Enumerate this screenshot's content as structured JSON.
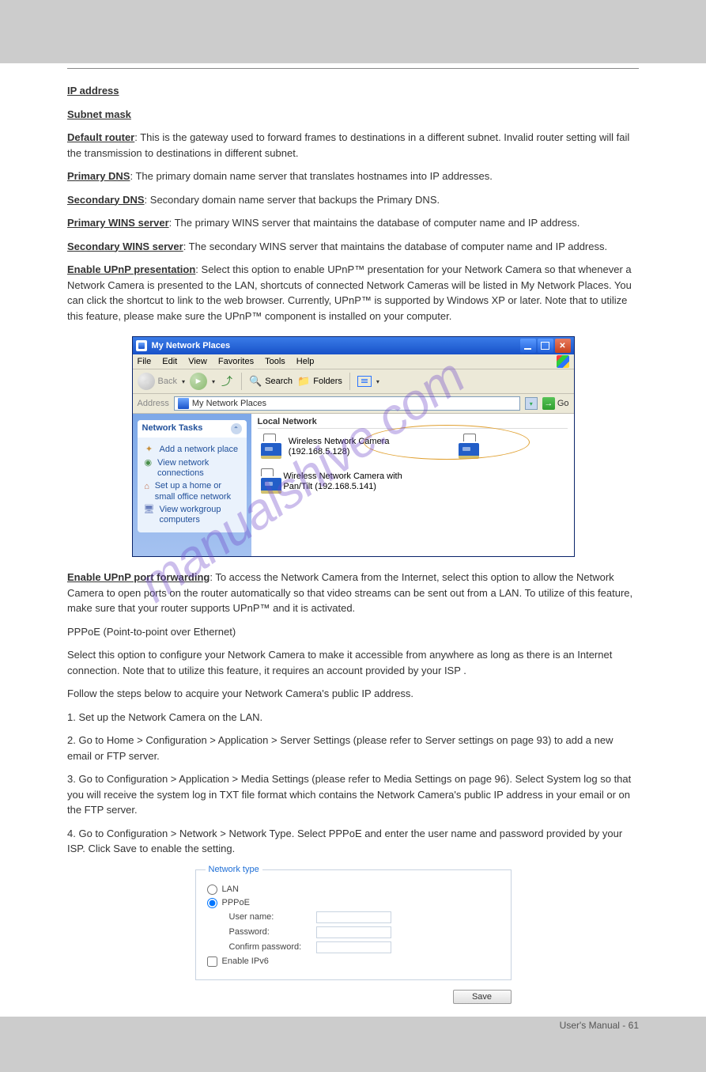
{
  "sections": {
    "ip_address": "IP address",
    "subnet_mask": "Subnet mask",
    "default_router": "Default router",
    "default_router_desc": ": This is the gateway used to forward frames to destinations in a different subnet. Invalid router setting will fail the transmission to destinations in different subnet.",
    "primary_dns": "Primary DNS",
    "primary_dns_desc": ": The primary domain name server that translates hostnames into IP addresses.",
    "secondary_dns": "Secondary DNS",
    "secondary_dns_desc": ": Secondary domain name server that backups the Primary DNS.",
    "primary_wins": "Primary WINS server",
    "primary_wins_desc": ": The primary WINS server that maintains the database of computer name and IP address.",
    "secondary_wins": "Secondary WINS server",
    "secondary_wins_desc": ": The secondary WINS server that maintains the database of computer name and IP address.",
    "enable_upnp": "Enable UPnP presentation",
    "enable_upnp_desc": ": Select this option to enable UPnP™ presentation for your Network Camera so that whenever a Network Camera is presented to the LAN, shortcuts of connected Network Cameras will be listed in My Network Places. You can click the shortcut to link to the web browser. Currently, UPnP™ is supported by Windows XP or later. Note that to utilize this feature, please make sure the UPnP™ component is installed on your computer.",
    "enable_portfwd": "Enable UPnP port forwarding",
    "enable_portfwd_desc": ": To access the Network Camera from the Internet, select this option to allow the Network Camera to open ports on the router automatically so that video streams can be sent out from a LAN. To utilize of this feature, make sure that your router supports UPnP™ and it is activated.",
    "pppoe_heading": "PPPoE (Point-to-point over Ethernet)",
    "pppoe_desc": "Select this option to configure your Network Camera to make it accessible from anywhere as long as there is an Internet connection. Note that to utilize this feature, it requires an account provided by your ISP .",
    "pppoe_steps": "Follow the steps below to acquire your Network Camera's public IP address.",
    "step1": "1. Set up the Network Camera on the LAN.",
    "step2": "2. Go to Home > Configuration > Application > Server Settings (please refer to Server settings on page 93) to add a new email or FTP server.",
    "step3": "3. Go to Configuration > Application > Media Settings (please refer to Media Settings on page 96). Select System log so that you will receive the system log in TXT file format which contains the Network Camera's public IP address in your email or on the FTP server.",
    "step4": "4. Go to Configuration > Network > Network Type. Select PPPoE and enter the user name and password provided by your ISP. Click Save to enable the setting."
  },
  "xp_window": {
    "title": "My Network Places",
    "menu": [
      "File",
      "Edit",
      "View",
      "Favorites",
      "Tools",
      "Help"
    ],
    "toolbar": {
      "back": "Back",
      "search": "Search",
      "folders": "Folders"
    },
    "address_label": "Address",
    "address": "My Network Places",
    "go": "Go",
    "tasks_title": "Network Tasks",
    "tasks": {
      "add": "Add a network place",
      "view": "View network connections",
      "setup": "Set up a home or small office network",
      "workgroup": "View workgroup computers"
    },
    "pane_title": "Local Network",
    "devices": {
      "cam1": "Wireless Network Camera (192.168.5.128)",
      "cam2": "Wireless Network Camera with Pan/Tilt (192.168.5.141)"
    }
  },
  "pppoe_form": {
    "legend": "Network type",
    "lan": "LAN",
    "pppoe": "PPPoE",
    "username": "User name:",
    "password": "Password:",
    "confirm": "Confirm password:",
    "ipv6": "Enable IPv6",
    "save": "Save"
  },
  "watermark": "manualshive.com",
  "page": "User's Manual - 61"
}
